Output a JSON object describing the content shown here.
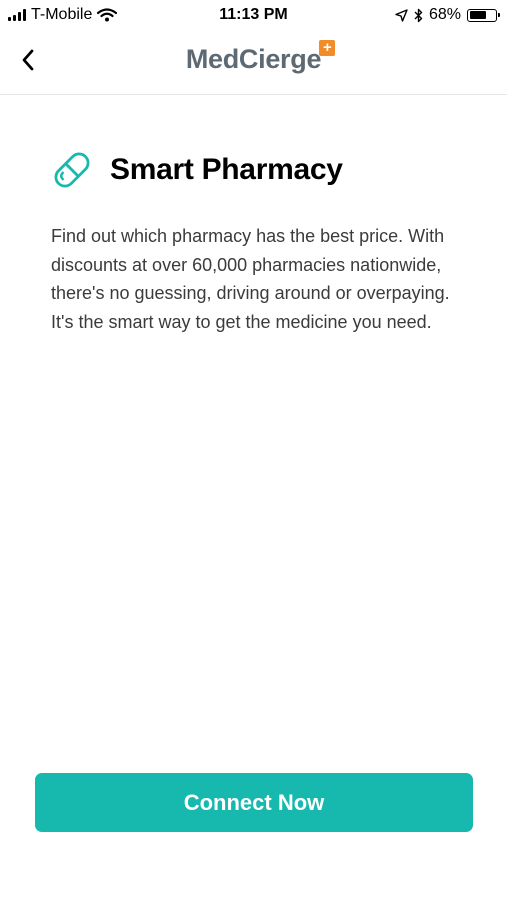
{
  "status_bar": {
    "carrier": "T-Mobile",
    "time": "11:13 PM",
    "battery": "68%",
    "battery_level": 0.68
  },
  "nav": {
    "logo_text": "MedCierge",
    "logo_badge": "+"
  },
  "feature": {
    "title": "Smart Pharmacy",
    "description": "Find out which pharmacy has the best price. With discounts at over 60,000 pharmacies nationwide, there's no guessing, driving around or overpaying. It's the smart way to get the medicine you need."
  },
  "cta": {
    "label": "Connect Now"
  },
  "colors": {
    "accent": "#17b8ad",
    "logo_badge": "#f28c28",
    "logo_text": "#5d6a73"
  },
  "icons": [
    "signal-bars-icon",
    "wifi-icon",
    "location-arrow-icon",
    "bluetooth-icon",
    "battery-icon",
    "chevron-left-icon",
    "pill-icon"
  ]
}
